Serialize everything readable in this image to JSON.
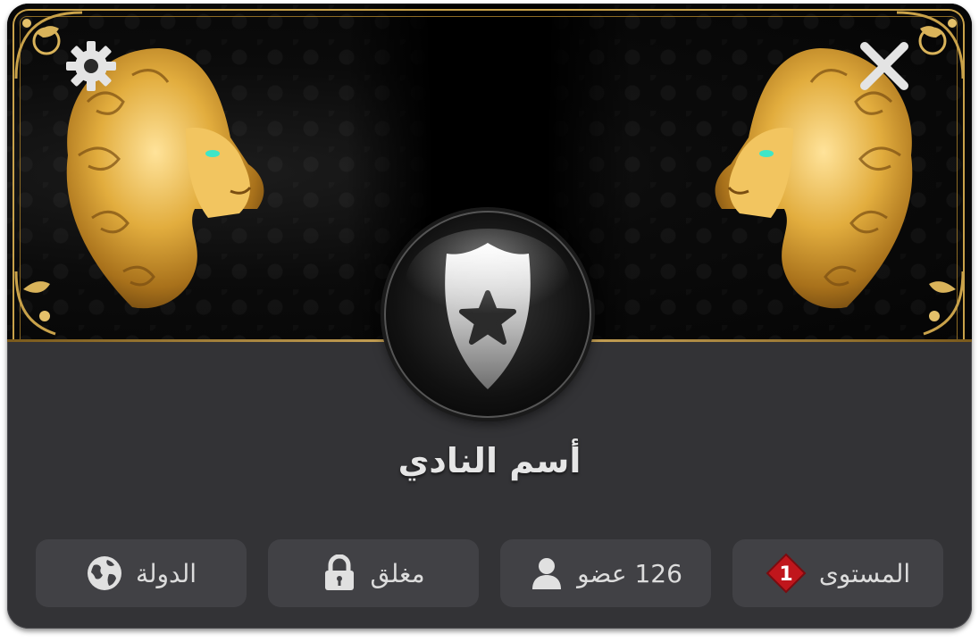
{
  "club": {
    "name": "أسم النادي"
  },
  "stats": {
    "level": {
      "label": "المستوى",
      "value": "1",
      "icon": "level-diamond-icon"
    },
    "members": {
      "label": "126 عضو",
      "icon": "user-icon"
    },
    "privacy": {
      "label": "مغلق",
      "icon": "lock-icon"
    },
    "country": {
      "label": "الدولة",
      "icon": "globe-icon"
    }
  },
  "toolbar": {
    "settings_icon": "gear-icon",
    "close_icon": "close-icon"
  },
  "colors": {
    "panel": "#333336",
    "chip": "#414145",
    "gold": "#c9a24a",
    "level_badge": "#c0161c",
    "text": "#e6e6e6"
  }
}
